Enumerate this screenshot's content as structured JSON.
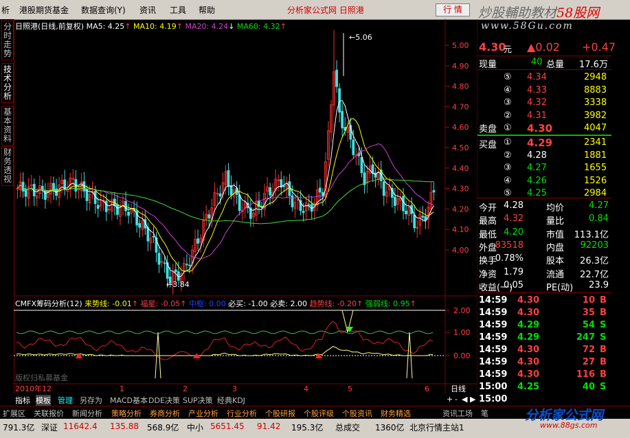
{
  "menubar": {
    "items": [
      "析",
      "港股期货基金",
      "数据查询(Y)",
      "资讯",
      "工具",
      "帮助"
    ],
    "brand": "分析家公式网  日照港",
    "quote_button": "行 情",
    "watermark_line1_a": "炒股輔助教材",
    "watermark_line1_b": "58股网",
    "watermark_line2": "www.58Gu.com"
  },
  "left_tabs": [
    "分时走势",
    "技术分析",
    "基本资料",
    "财务透视"
  ],
  "main_chart": {
    "title": "日照港(日线,前复权)",
    "ma5": "MA5: 4.25",
    "ma10": "MA10: 4.19",
    "ma20": "MA20: 4.24",
    "ma60": "MA60: 4.32",
    "high_label": "5.06",
    "low_label": "3.84",
    "yaxis": [
      "5.00",
      "4.90",
      "4.80",
      "4.70",
      "4.60",
      "4.50",
      "4.40",
      "4.30",
      "4.20",
      "4.10",
      "4.00"
    ],
    "colors": {
      "up": "#ff3030",
      "down": "#40e0e0",
      "ma5": "#ffffff",
      "ma10": "#ffff00",
      "ma20": "#d040d0",
      "ma60": "#40e040"
    }
  },
  "indicator": {
    "name": "CMFX筹码分析(12)",
    "trend": "来势线: -0.01",
    "bull": "福星: -0.05",
    "mid": "中枢: 0.00",
    "buy": "必买: -1.00",
    "sell": "必卖: 2.00",
    "trend2": "趋势线: -0.20",
    "strength": "强弱线: 0.95",
    "yaxis": [
      "2.00",
      "1.00",
      "0.00"
    ],
    "watermark": "版权归私募基金"
  },
  "xaxis": {
    "labels": [
      "2010年12",
      "1",
      "2",
      "3",
      "4",
      "5",
      "6"
    ],
    "period": "日线"
  },
  "quote": {
    "price": "4.30",
    "unit": "元",
    "change": "▲0.02",
    "pct": "+0.47",
    "volume_label": "现量",
    "volume": "40",
    "total_label": "总量",
    "total": "17.6万",
    "sell_label": "卖盘",
    "buy_label": "买盘",
    "asks": [
      {
        "lvl": "⑤",
        "price": "4.34",
        "vol": "2948"
      },
      {
        "lvl": "④",
        "price": "4.33",
        "vol": "8883"
      },
      {
        "lvl": "③",
        "price": "4.32",
        "vol": "3338"
      },
      {
        "lvl": "②",
        "price": "4.31",
        "vol": "3982"
      },
      {
        "lvl": "①",
        "price": "4.30",
        "vol": "4047"
      }
    ],
    "bids": [
      {
        "lvl": "①",
        "price": "4.29",
        "vol": "2341"
      },
      {
        "lvl": "②",
        "price": "4.28",
        "vol": "1881"
      },
      {
        "lvl": "③",
        "price": "4.27",
        "vol": "1655"
      },
      {
        "lvl": "④",
        "price": "4.26",
        "vol": "1526"
      },
      {
        "lvl": "⑤",
        "price": "4.25",
        "vol": "2984"
      }
    ],
    "stats": [
      {
        "k1": "今开",
        "v1": "4.28",
        "k2": "均价",
        "v2": "4.27",
        "c1": "wh",
        "c2": "dn"
      },
      {
        "k1": "最高",
        "v1": "4.32",
        "k2": "量比",
        "v2": "0.84",
        "c1": "up",
        "c2": "dn"
      },
      {
        "k1": "最低",
        "v1": "4.20",
        "k2": "市值",
        "v2": "113.1亿",
        "c1": "dn",
        "c2": "wh"
      },
      {
        "k1": "外盘",
        "v1": "83518",
        "k2": "内盘",
        "v2": "92203",
        "c1": "up",
        "c2": "dn"
      },
      {
        "k1": "换手",
        "v1": "0.78%",
        "k2": "股本",
        "v2": "26.3亿",
        "c1": "wh",
        "c2": "wh"
      },
      {
        "k1": "净资",
        "v1": "1.79",
        "k2": "流通",
        "v2": "22.7亿",
        "c1": "wh",
        "c2": "wh"
      },
      {
        "k1": "收益(一)",
        "v1": "0.05",
        "k2": "PE(动)",
        "v2": "23.9",
        "c1": "wh",
        "c2": "wh"
      }
    ],
    "ticks": [
      {
        "t": "14:59",
        "p": "4.30",
        "v": "10",
        "s": "B"
      },
      {
        "t": "14:59",
        "p": "4.30",
        "v": "35",
        "s": "B"
      },
      {
        "t": "14:59",
        "p": "4.29",
        "v": "54",
        "s": "S"
      },
      {
        "t": "14:59",
        "p": "4.29",
        "v": "247",
        "s": "S"
      },
      {
        "t": "14:59",
        "p": "4.30",
        "v": "72",
        "s": "B"
      },
      {
        "t": "14:59",
        "p": "4.30",
        "v": "27",
        "s": "B"
      },
      {
        "t": "14:59",
        "p": "4.30",
        "v": "116",
        "s": "B"
      },
      {
        "t": "15:00",
        "p": "4.25",
        "v": "40",
        "s": "S"
      },
      {
        "t": "15:00",
        "p": "",
        "v": "",
        "s": ""
      }
    ]
  },
  "toolbar": [
    "指标",
    "模板",
    "管理",
    "另存为",
    "MACD基本",
    "DDE决策",
    "SUP决策",
    "经典KDJ"
  ],
  "toolbar_right": [
    "+",
    "-",
    "◀",
    "▶"
  ],
  "tabbar": [
    "扩展区",
    "关联报价",
    "新闻分析",
    "策略分析",
    "券商分析",
    "产业分析",
    "行业分析",
    "个股研报",
    "个股评级",
    "个股资讯",
    "财务精选",
    "资讯工场",
    "笔"
  ],
  "statusbar": [
    {
      "k": "791.3亿",
      "c": "#000"
    },
    {
      "k": "深证",
      "c": "#000"
    },
    {
      "k": "11642.4",
      "c": "#d00000"
    },
    {
      "k": "135.88",
      "c": "#d00000"
    },
    {
      "k": "568.9亿",
      "c": "#000"
    },
    {
      "k": "中小",
      "c": "#000"
    },
    {
      "k": "5651.45",
      "c": "#d00000"
    },
    {
      "k": "91.42",
      "c": "#d00000"
    },
    {
      "k": "195.3亿",
      "c": "#000"
    },
    {
      "k": "总成交",
      "c": "#000"
    },
    {
      "k": "1360亿",
      "c": "#000"
    },
    {
      "k": "北京行情主站1",
      "c": "#000"
    }
  ],
  "logo": {
    "text": "分析家公式网",
    "sub": "www.88gs.com"
  }
}
